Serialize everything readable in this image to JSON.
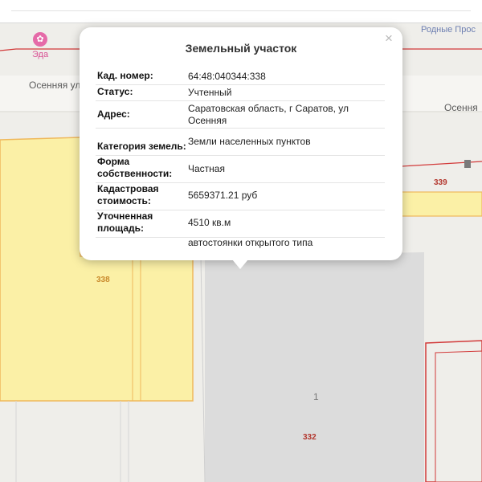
{
  "popup": {
    "title": "Земельный участок",
    "close_icon": "×",
    "fields": [
      {
        "key": "Кад. номер:",
        "value": "64:48:040344:338"
      },
      {
        "key": "Статус:",
        "value": "Учтенный"
      },
      {
        "key": "Адрес:",
        "value": "Саратовская область, г Саратов, ул Осенняя"
      },
      {
        "key": "Категория земель:",
        "value": "Земли населенных пунктов"
      },
      {
        "key": "Форма собственности:",
        "value": "Частная"
      },
      {
        "key": "Кадастровая стоимость:",
        "value": "5659371.21 руб"
      },
      {
        "key": "Уточненная площадь:",
        "value": "4510 кв.м"
      },
      {
        "key": "",
        "value": "автостоянки открытого типа"
      }
    ]
  },
  "map": {
    "street_labels": [
      "Осенняя улица",
      "Осення"
    ],
    "poi": {
      "name": "Эда",
      "icon": "restaurant-icon"
    },
    "brand_label": "Родные Прос",
    "parcel_numbers": [
      "339",
      "338",
      "332"
    ],
    "building_number": "1",
    "colors": {
      "selected_parcel_fill": "#fbf0a6",
      "selected_parcel_stroke": "#efb85c",
      "parcel_border": "#d23a3a",
      "parcel_number_red": "#b3372e",
      "parcel_number_orange": "#c98a2c"
    }
  }
}
